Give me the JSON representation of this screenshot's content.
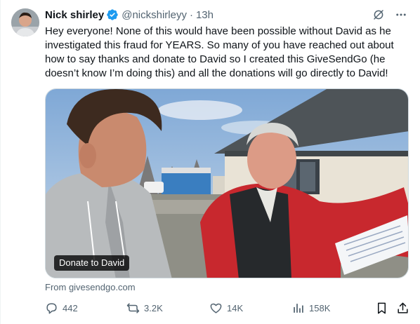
{
  "tweet": {
    "display_name": "Nick shirley",
    "handle": "@nickshirleyy",
    "separator": "·",
    "time": "13h",
    "text": "Hey everyone! None of this would have been possible without David as he investigated this fraud for YEARS. So many of you have reached out about how to say thanks and donate to David so I created this GiveSendGo (he doesn’t know I’m doing this) and all the donations will go directly to David!",
    "media_label": "Donate to David",
    "source": "From givesendgo.com",
    "verified_color": "#1d9bf0"
  },
  "metrics": {
    "replies": "442",
    "reposts": "3.2K",
    "likes": "14K",
    "views": "158K"
  },
  "icons": [
    "verified-icon",
    "grok-icon",
    "more-icon",
    "reply-icon",
    "repost-icon",
    "like-icon",
    "views-icon",
    "bookmark-icon",
    "share-icon"
  ]
}
